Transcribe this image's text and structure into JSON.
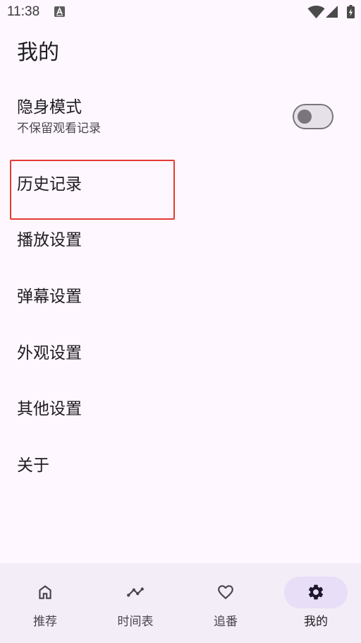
{
  "status_bar": {
    "time": "11:38",
    "icons": [
      "a-letter-notification-icon",
      "wifi-icon",
      "signal-icon",
      "battery-charging-icon"
    ]
  },
  "page": {
    "title": "我的"
  },
  "incognito": {
    "title": "隐身模式",
    "subtitle": "不保留观看记录",
    "enabled": false
  },
  "menu": {
    "items": [
      {
        "label": "历史记录"
      },
      {
        "label": "播放设置"
      },
      {
        "label": "弹幕设置"
      },
      {
        "label": "外观设置"
      },
      {
        "label": "其他设置"
      },
      {
        "label": "关于"
      }
    ]
  },
  "bottom_nav": {
    "items": [
      {
        "label": "推荐",
        "icon": "home-icon",
        "selected": false
      },
      {
        "label": "时间表",
        "icon": "timeline-icon",
        "selected": false
      },
      {
        "label": "追番",
        "icon": "heart-icon",
        "selected": false
      },
      {
        "label": "我的",
        "icon": "settings-gear-icon",
        "selected": true
      }
    ]
  },
  "colors": {
    "surface": "#fef7ff",
    "nav_bg": "#f3edf7",
    "indicator": "#e8def8",
    "on_surface": "#1d1b20",
    "on_surface_variant": "#49454f",
    "outline": "#79747e",
    "track_off": "#e6e0e9",
    "highlight": "#e53935"
  }
}
